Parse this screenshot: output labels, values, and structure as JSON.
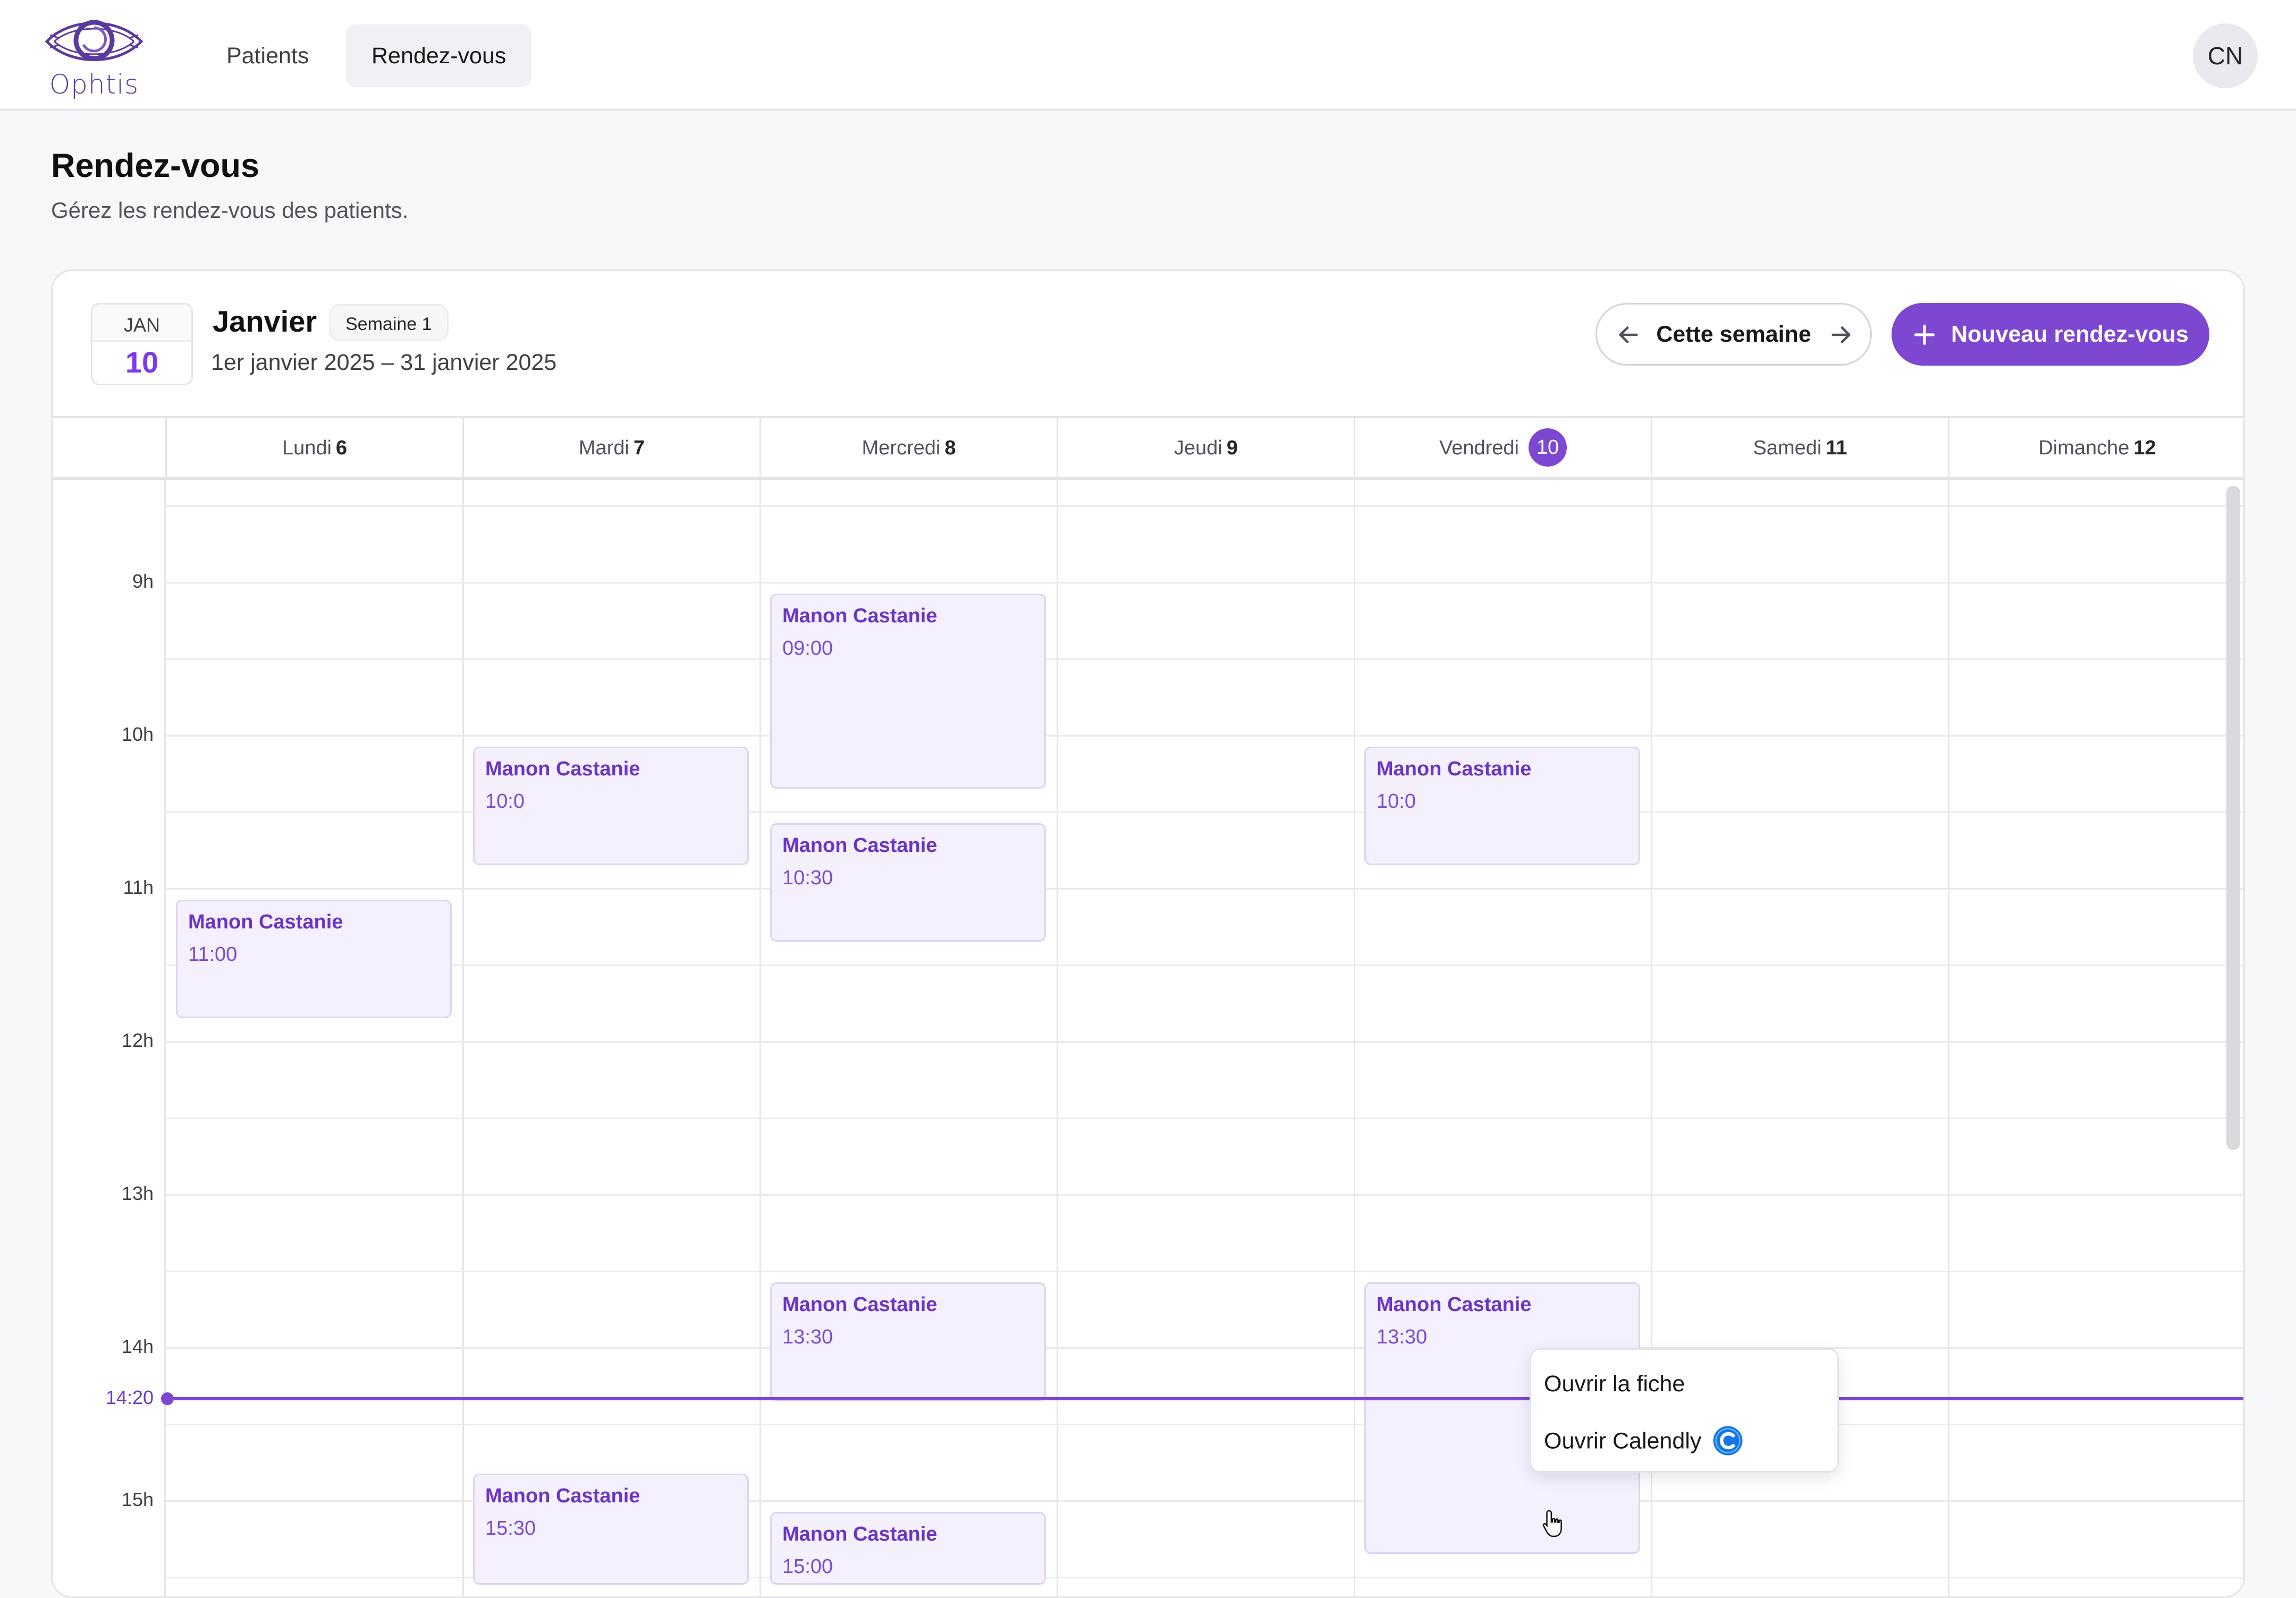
{
  "nav": {
    "brand": "Ophtis",
    "links": [
      {
        "label": "Patients",
        "active": false
      },
      {
        "label": "Rendez-vous",
        "active": true
      }
    ],
    "avatar_initials": "CN"
  },
  "page": {
    "title": "Rendez-vous",
    "subtitle": "Gérez les rendez-vous des patients."
  },
  "calendar": {
    "date_badge": {
      "month": "JAN",
      "day": "10"
    },
    "month_title": "Janvier",
    "week_badge": "Semaine 1",
    "range": "1er janvier 2025 – 31 janvier 2025",
    "this_week_label": "Cette semaine",
    "new_button_label": "Nouveau rendez-vous",
    "days": [
      {
        "name": "Lundi",
        "num": "6",
        "today": false
      },
      {
        "name": "Mardi",
        "num": "7",
        "today": false
      },
      {
        "name": "Mercredi",
        "num": "8",
        "today": false
      },
      {
        "name": "Jeudi",
        "num": "9",
        "today": false
      },
      {
        "name": "Vendredi",
        "num": "10",
        "today": true
      },
      {
        "name": "Samedi",
        "num": "11",
        "today": false
      },
      {
        "name": "Dimanche",
        "num": "12",
        "today": false
      }
    ],
    "hour_labels": [
      "9h",
      "10h",
      "11h",
      "12h",
      "13h",
      "14h",
      "15h"
    ],
    "now_label": "14:20",
    "events": [
      {
        "day": 0,
        "name": "Manon Castanie",
        "time": "11:00",
        "start": 11.0,
        "end": 11.9
      },
      {
        "day": 1,
        "name": "Manon Castanie",
        "time": "10:0",
        "start": 10.0,
        "end": 10.9
      },
      {
        "day": 1,
        "name": "Manon Castanie",
        "time": "15:30",
        "start": 14.75,
        "end": 15.6
      },
      {
        "day": 2,
        "name": "Manon Castanie",
        "time": "09:00",
        "start": 9.0,
        "end": 10.4
      },
      {
        "day": 2,
        "name": "Manon Castanie",
        "time": "10:30",
        "start": 10.5,
        "end": 11.4
      },
      {
        "day": 2,
        "name": "Manon Castanie",
        "time": "13:30",
        "start": 13.5,
        "end": 14.4
      },
      {
        "day": 2,
        "name": "Manon Castanie",
        "time": "15:00",
        "start": 15.0,
        "end": 15.6
      },
      {
        "day": 4,
        "name": "Manon Castanie",
        "time": "10:0",
        "start": 10.0,
        "end": 10.9
      },
      {
        "day": 4,
        "name": "Manon Castanie",
        "time": "13:30",
        "start": 13.5,
        "end": 15.4
      }
    ]
  },
  "context_menu": {
    "open_record": "Ouvrir la fiche",
    "open_calendly": "Ouvrir Calendly"
  },
  "colors": {
    "accent": "#7e47d1",
    "event_bg": "#f4f0fd",
    "event_text": "#6b35c4"
  }
}
